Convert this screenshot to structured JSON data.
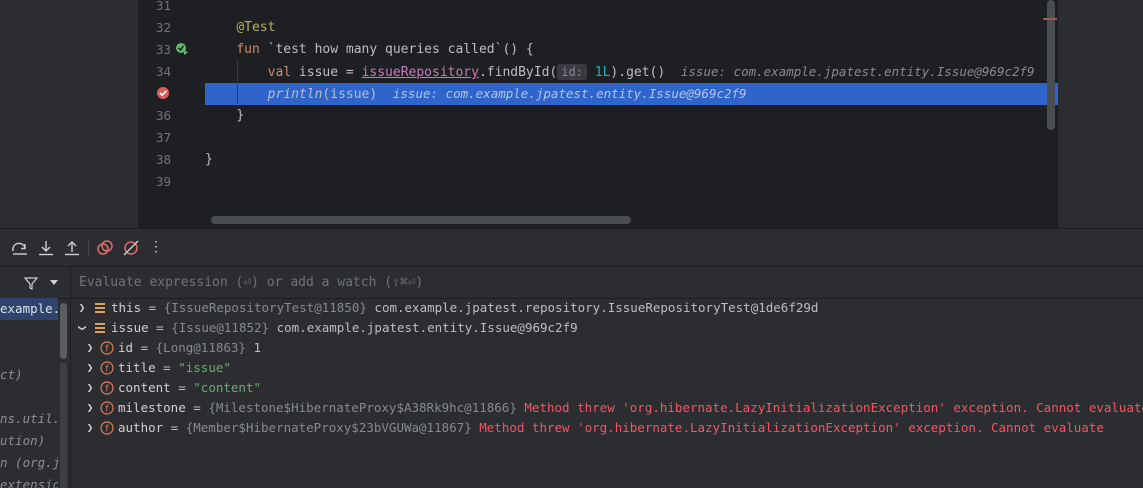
{
  "editor": {
    "line_numbers": [
      "31",
      "32",
      "33",
      "34",
      "35",
      "36",
      "37",
      "38",
      "39"
    ],
    "line32_annotation": "@Test",
    "line33_fun": "fun",
    "line33_name": "`test how many queries called`",
    "line33_rest": "() {",
    "line34_val": "val",
    "line34_var": " issue = ",
    "line34_repo": "issueRepository",
    "line34_call": ".findById(",
    "line34_hint": "id:",
    "line34_arg": "1L",
    "line34_end": ").get()",
    "line34_inline": "issue: com.example.jpatest.entity.Issue@969c2f9",
    "line35_fn": "println",
    "line35_args": "(issue)",
    "line35_inline": "issue: com.example.jpatest.entity.Issue@969c2f9",
    "line36": "}",
    "line38": "}"
  },
  "toolbar": {
    "icons": [
      "step-over-icon",
      "step-into-icon",
      "step-out-icon",
      "view-breakpoints-icon",
      "mute-breakpoints-icon",
      "more-icon"
    ],
    "more_label": "⋮"
  },
  "frames": {
    "items": [
      "example.j",
      "",
      "ct)",
      "ns.util.",
      "ution)",
      "n (org.j",
      "extensio"
    ]
  },
  "evaluate": {
    "placeholder": "Evaluate expression (⏎) or add a watch (⇧⌘⏎)"
  },
  "variables": [
    {
      "name": "this",
      "type": "{IssueRepositoryTest@11850}",
      "value": "com.example.jpatest.repository.IssueRepositoryTest@1de6f29d",
      "expanded": false,
      "kind": "object"
    },
    {
      "name": "issue",
      "type": "{Issue@11852}",
      "value": "com.example.jpatest.entity.Issue@969c2f9",
      "expanded": true,
      "kind": "object"
    },
    {
      "name": "id",
      "type": "{Long@11863}",
      "value": "1",
      "expanded": false,
      "kind": "field"
    },
    {
      "name": "title",
      "type": "",
      "value": "\"issue\"",
      "expanded": false,
      "kind": "field"
    },
    {
      "name": "content",
      "type": "",
      "value": "\"content\"",
      "expanded": false,
      "kind": "field"
    },
    {
      "name": "milestone",
      "type": "{Milestone$HibernateProxy$A38Rk9hc@11866}",
      "value": "Method threw 'org.hibernate.LazyInitializationException' exception. Cannot evaluate",
      "expanded": false,
      "kind": "field"
    },
    {
      "name": "author",
      "type": "{Member$HibernateProxy$23bVGUWa@11867}",
      "value": "Method threw 'org.hibernate.LazyInitializationException' exception. Cannot evaluate",
      "expanded": false,
      "kind": "field"
    }
  ],
  "colors": {
    "editor_bg": "#1e1f22",
    "panel_bg": "#2b2d30",
    "highlight_line": "#2f65ca",
    "keyword": "#cf8e6d",
    "annotation": "#b3ae60",
    "string": "#6aab73",
    "error": "#f75464",
    "field_icon": "#e27c5b"
  }
}
